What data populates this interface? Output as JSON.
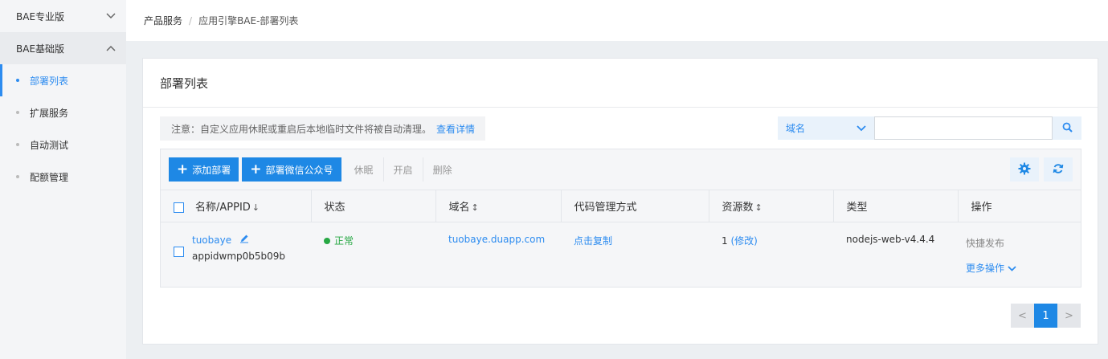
{
  "sidebar": {
    "groups": [
      {
        "label": "BAE专业版"
      },
      {
        "label": "BAE基础版"
      }
    ],
    "items": [
      {
        "label": "部署列表",
        "active": true
      },
      {
        "label": "扩展服务"
      },
      {
        "label": "自动测试"
      },
      {
        "label": "配额管理"
      }
    ]
  },
  "breadcrumb": {
    "items": [
      "产品服务",
      "应用引擎BAE-部署列表"
    ],
    "separator": "/"
  },
  "panel": {
    "title": "部署列表"
  },
  "notice": {
    "text": "注意：自定义应用休眠或重启后本地临时文件将被自动清理。",
    "link": "查看详情"
  },
  "search": {
    "select_value": "域名",
    "input_value": ""
  },
  "toolbar": {
    "add_deploy": "添加部署",
    "add_wechat": "部署微信公众号",
    "sleep": "休眠",
    "start": "开启",
    "delete": "删除"
  },
  "table": {
    "columns": [
      "名称/APPID",
      "状态",
      "域名",
      "代码管理方式",
      "资源数",
      "类型",
      "操作"
    ],
    "rows": [
      {
        "name": "tuobaye",
        "appid": "appidwmp0b5b09b",
        "status": "正常",
        "domain": "tuobaye.duapp.com",
        "code_mgmt": "点击复制",
        "resources": "1",
        "resources_edit": "(修改)",
        "type": "nodejs-web-v4.4.4",
        "op_quick": "快捷发布",
        "op_more": "更多操作"
      }
    ]
  },
  "pagination": {
    "prev": "<",
    "current": "1",
    "next": ">"
  },
  "colors": {
    "accent": "#1e88e5",
    "status_ok": "#27a844"
  }
}
